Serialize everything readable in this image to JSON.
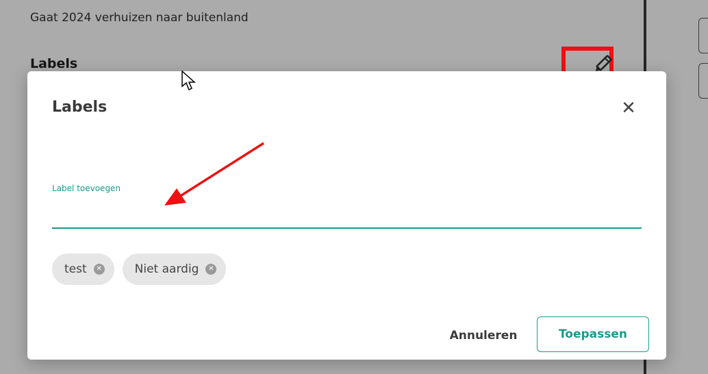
{
  "background": {
    "description": "Gaat 2024 verhuizen naar buitenland",
    "labels_heading": "Labels"
  },
  "modal": {
    "title": "Labels",
    "close_icon": "close-icon",
    "field_label": "Label toevoegen",
    "field_value": "",
    "chips": [
      {
        "label": "test"
      },
      {
        "label": "Niet aardig"
      }
    ],
    "cancel_label": "Annuleren",
    "apply_label": "Toepassen"
  },
  "colors": {
    "accent": "#1a9a8a",
    "highlight": "#ee1111",
    "overlay": "rgba(0,0,0,0.33)"
  }
}
